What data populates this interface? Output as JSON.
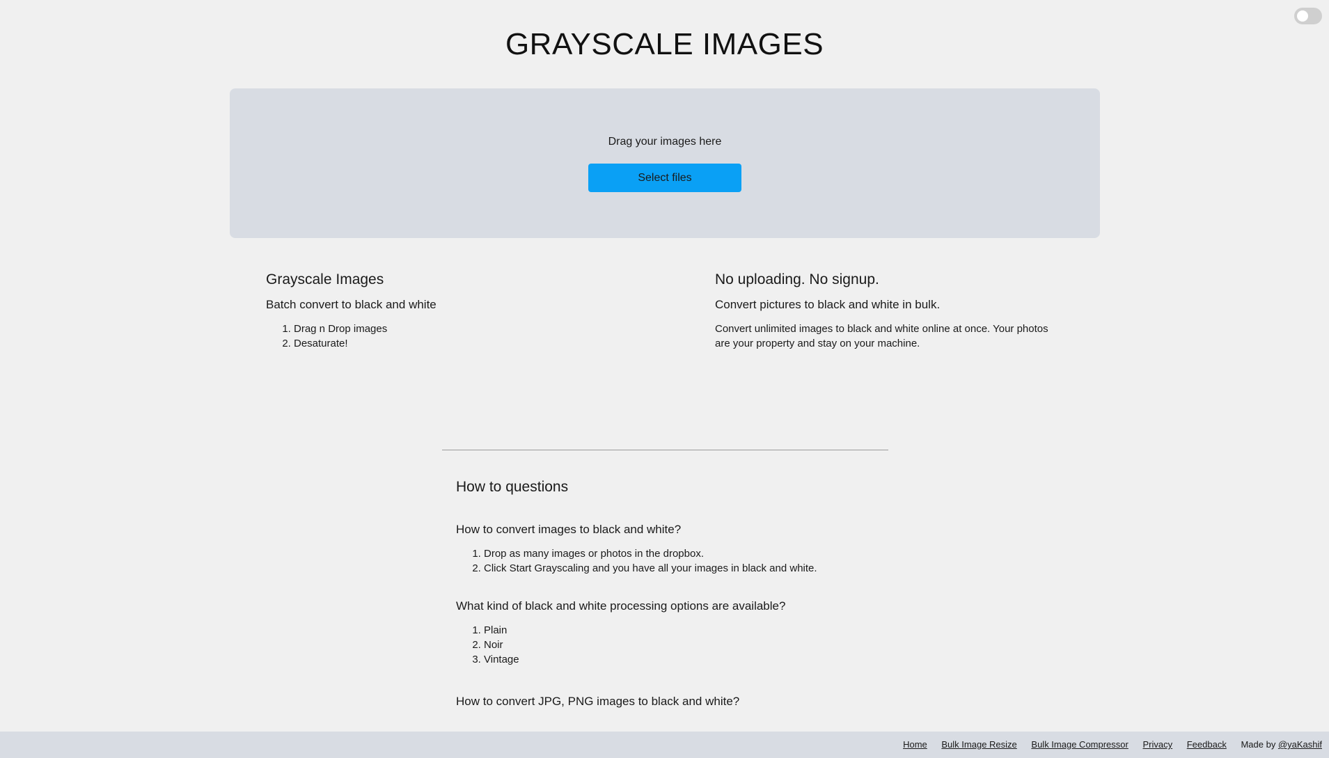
{
  "header": {
    "title": "GRAYSCALE IMAGES"
  },
  "theme_toggle": {
    "state": "off"
  },
  "dropzone": {
    "drag_text": "Drag your images here",
    "button_label": "Select files"
  },
  "info_left": {
    "title": "Grayscale Images",
    "subtitle": "Batch convert to black and white",
    "steps": [
      "Drag n Drop images",
      "Desaturate!"
    ]
  },
  "info_right": {
    "title": "No uploading. No signup.",
    "subtitle": "Convert pictures to black and white in bulk.",
    "text": "Convert unlimited images to black and white online at once. Your photos are your property and stay on your machine."
  },
  "faq": {
    "heading": "How to questions",
    "questions": [
      {
        "question": "How to convert images to black and white?",
        "answers": [
          "Drop as many images or photos in the dropbox.",
          "Click Start Grayscaling and you have all your images in black and white."
        ]
      },
      {
        "question": "What kind of black and white processing options are available?",
        "answers": [
          "Plain",
          "Noir",
          "Vintage"
        ]
      },
      {
        "question": "How to convert JPG, PNG images to black and white?"
      }
    ]
  },
  "footer": {
    "links": [
      "Home",
      "Bulk Image Resize",
      "Bulk Image Compressor",
      "Privacy",
      "Feedback"
    ],
    "made_by_prefix": "Made by ",
    "made_by_link": "@yaKashif"
  },
  "colors": {
    "background": "#f0f0f0",
    "panel": "#d8dce3",
    "accent": "#0aa0f5"
  }
}
